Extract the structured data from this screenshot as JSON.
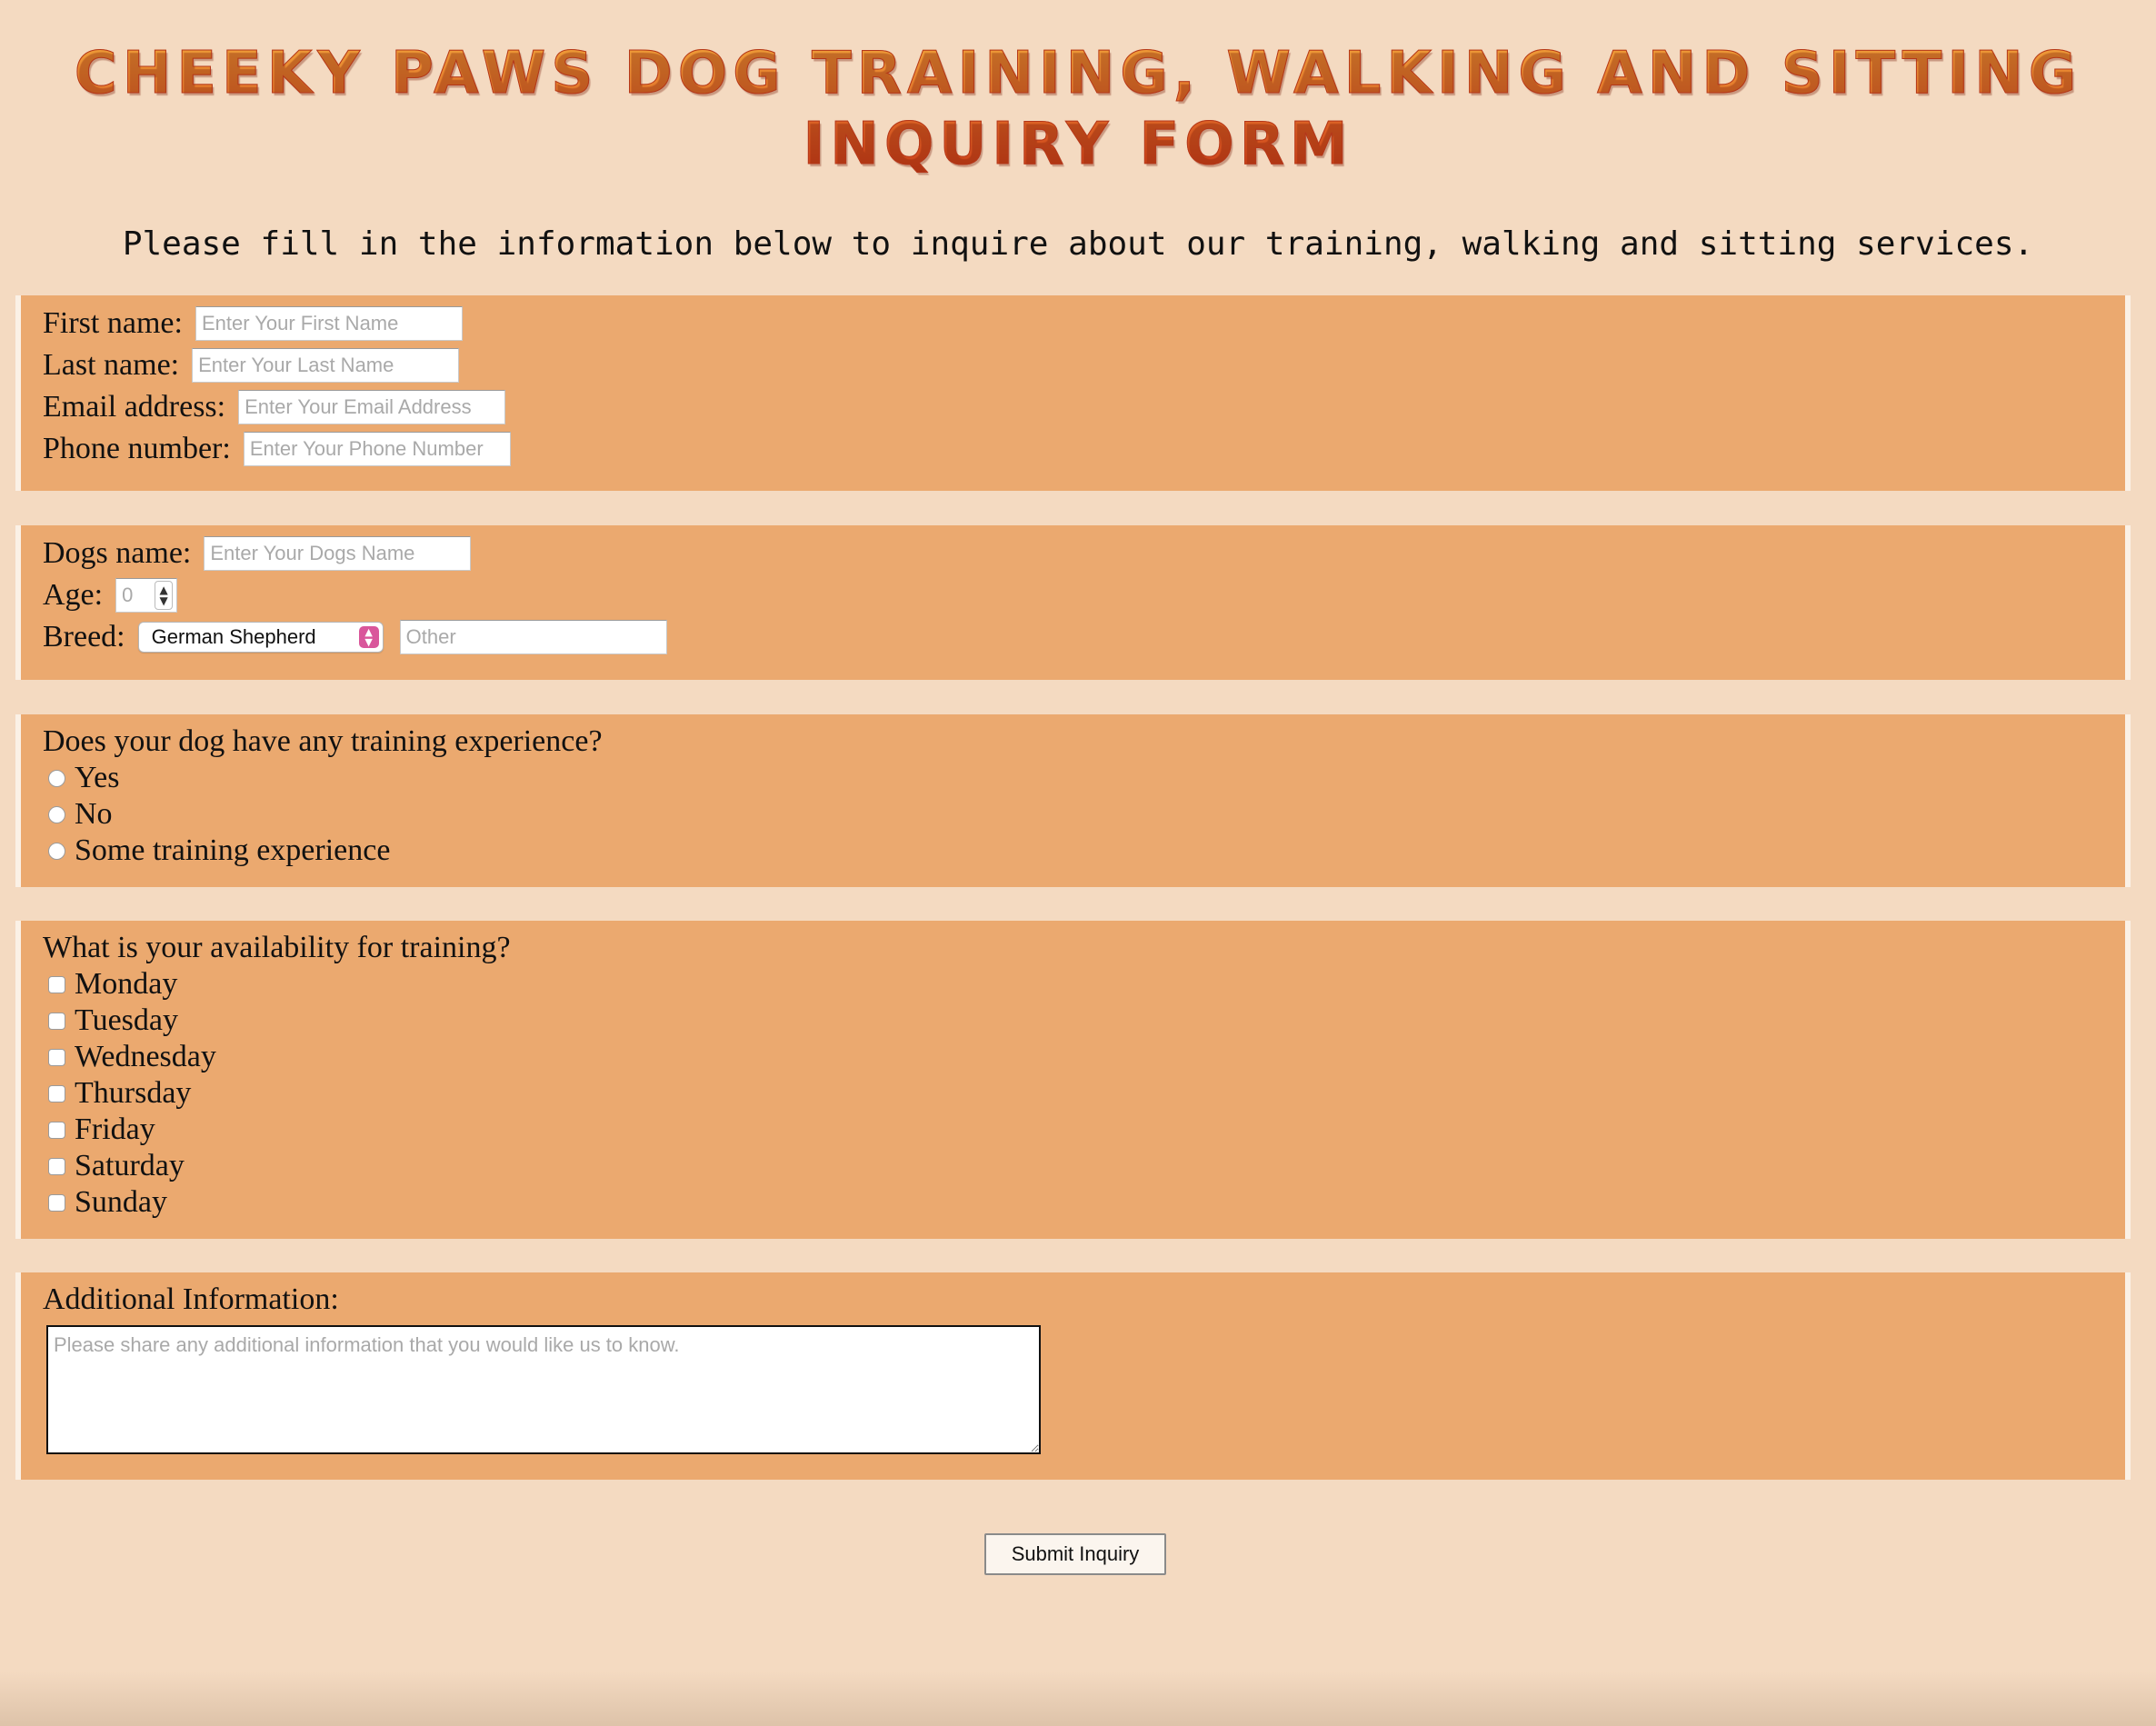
{
  "title": "Cheeky Paws Dog Training, Walking and Sitting Inquiry Form",
  "intro": "Please fill in the information below to inquire about our training, walking and sitting services.",
  "owner": {
    "first_name_label": "First name:",
    "first_name_placeholder": "Enter Your First Name",
    "last_name_label": "Last name:",
    "last_name_placeholder": "Enter Your Last Name",
    "email_label": "Email address:",
    "email_placeholder": "Enter Your Email Address",
    "phone_label": "Phone number:",
    "phone_placeholder": "Enter Your Phone Number"
  },
  "dog": {
    "name_label": "Dogs name:",
    "name_placeholder": "Enter Your Dogs Name",
    "age_label": "Age:",
    "age_placeholder": "0",
    "breed_label": "Breed:",
    "breed_selected": "German Shepherd",
    "other_placeholder": "Other"
  },
  "training_experience": {
    "question": "Does your dog have any training experience?",
    "options": [
      "Yes",
      "No",
      "Some training experience"
    ]
  },
  "availability": {
    "question": "What is your availability for training?",
    "days": [
      "Monday",
      "Tuesday",
      "Wednesday",
      "Thursday",
      "Friday",
      "Saturday",
      "Sunday"
    ]
  },
  "additional": {
    "label": "Additional Information:",
    "placeholder": "Please share any additional information that you would like us to know."
  },
  "submit_label": "Submit Inquiry",
  "colors": {
    "page_background": "#f4dac1",
    "panel_background": "#eba96f",
    "title_gradient_top": "#f0a33a",
    "title_gradient_bottom": "#c93a17",
    "select_arrow_accent": "#d9569b"
  }
}
